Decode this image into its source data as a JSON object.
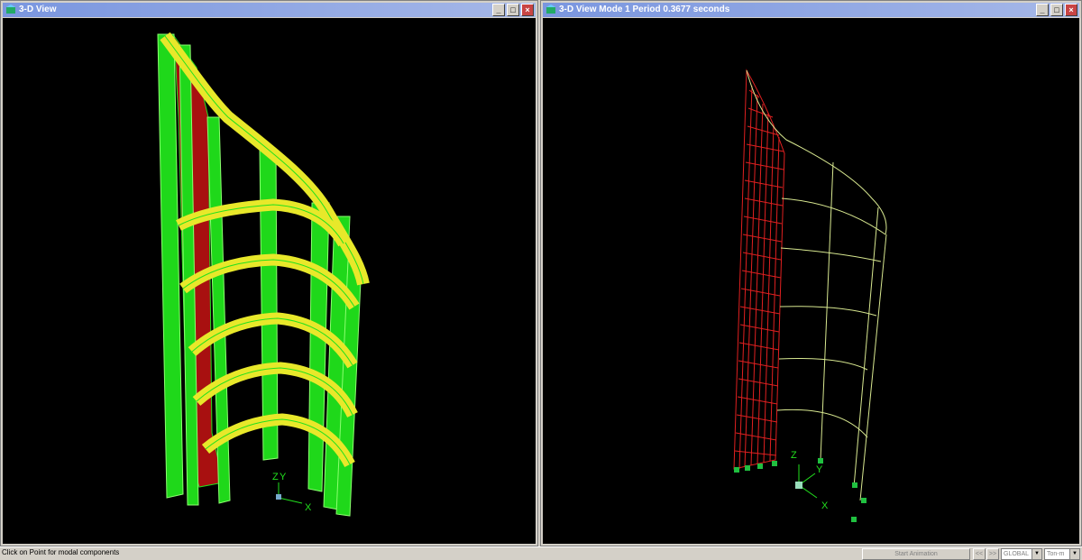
{
  "left_window": {
    "title": "3-D View",
    "axis_labels": {
      "z": "Z",
      "y": "Y",
      "x": "X"
    }
  },
  "right_window": {
    "title": "3-D View  Mode 1  Period 0.3677 seconds",
    "axis_labels": {
      "z": "Z",
      "y": "Y",
      "x": "X"
    }
  },
  "window_buttons": {
    "minimize": "_",
    "maximize": "□",
    "close": "×"
  },
  "statusbar": {
    "message": "Click on Point for modal components",
    "start_animation": "Start Animation",
    "prev": "<<",
    "next": ">>",
    "coord_system": "GLOBAL",
    "units": "Ton-m"
  },
  "colors": {
    "canvas_bg": "#000000",
    "frame_green": "#22e01e",
    "frame_yellow": "#e8e82a",
    "wall_red": "#b01010",
    "mesh_red": "#e02020",
    "deformed_line": "#d8e890",
    "support_green": "#20c040"
  }
}
